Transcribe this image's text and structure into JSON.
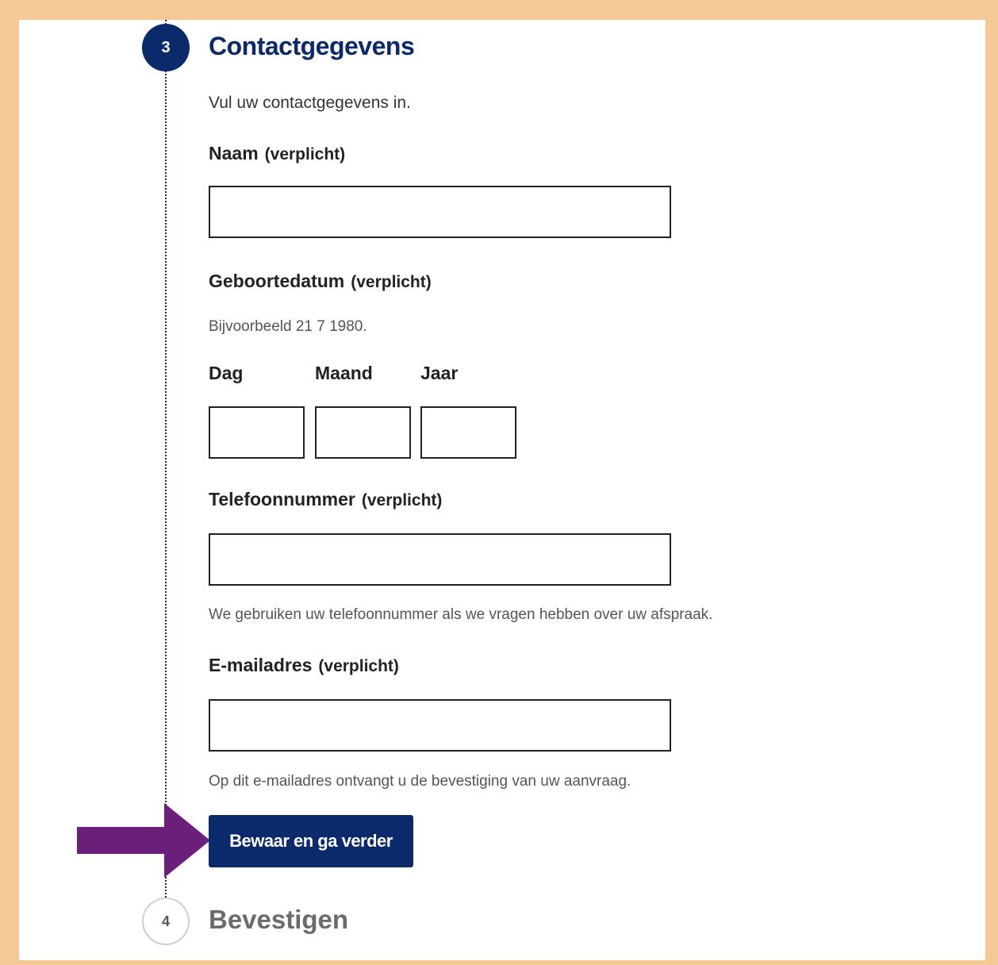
{
  "step_current": {
    "number": "3",
    "title": "Contactgegevens",
    "intro": "Vul uw contactgegevens in."
  },
  "required_marker": "(verplicht)",
  "fields": {
    "naam": {
      "label": "Naam",
      "value": ""
    },
    "geboortedatum": {
      "label": "Geboortedatum",
      "hint": "Bijvoorbeeld 21 7 1980.",
      "dag_label": "Dag",
      "maand_label": "Maand",
      "jaar_label": "Jaar"
    },
    "telefoon": {
      "label": "Telefoonnummer",
      "value": "",
      "hint": "We gebruiken uw telefoonnummer als we vragen hebben over uw afspraak."
    },
    "email": {
      "label": "E-mailadres",
      "value": "",
      "hint": "Op dit e-mailadres ontvangt u de bevestiging van uw aanvraag."
    }
  },
  "submit_label": "Bewaar en ga verder",
  "step_next": {
    "number": "4",
    "title": "Bevestigen"
  },
  "colors": {
    "primary": "#0b2a6b",
    "arrow": "#6a1f7a",
    "frame": "#f6c994"
  },
  "icons": {
    "pointer": "arrow-right-icon"
  }
}
